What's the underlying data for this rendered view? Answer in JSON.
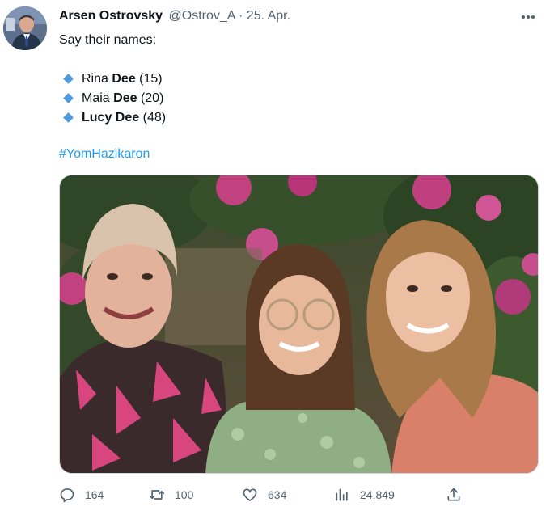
{
  "author": {
    "name": "Arsen Ostrovsky",
    "handle": "@Ostrov_A",
    "separator": "·",
    "date": "25. Apr."
  },
  "tweet": {
    "intro": "Say their names:",
    "names": [
      {
        "first": "Rina",
        "last": "Dee",
        "age": "(15)"
      },
      {
        "first": "Maia",
        "last": "Dee",
        "age": "(20)"
      },
      {
        "first": "Lucy",
        "last": "Dee",
        "age": "(48)"
      }
    ],
    "hashtag": "#YomHazikaron"
  },
  "actions": {
    "replies": "164",
    "retweets": "100",
    "likes": "634",
    "views": "24.849"
  },
  "colors": {
    "accent": "#1d9bf0",
    "bullet": "#4f9be0",
    "secondary_text": "#536471"
  },
  "icons": [
    "more-icon",
    "reply-icon",
    "retweet-icon",
    "like-icon",
    "views-icon",
    "share-icon",
    "diamond-bullet-icon"
  ]
}
